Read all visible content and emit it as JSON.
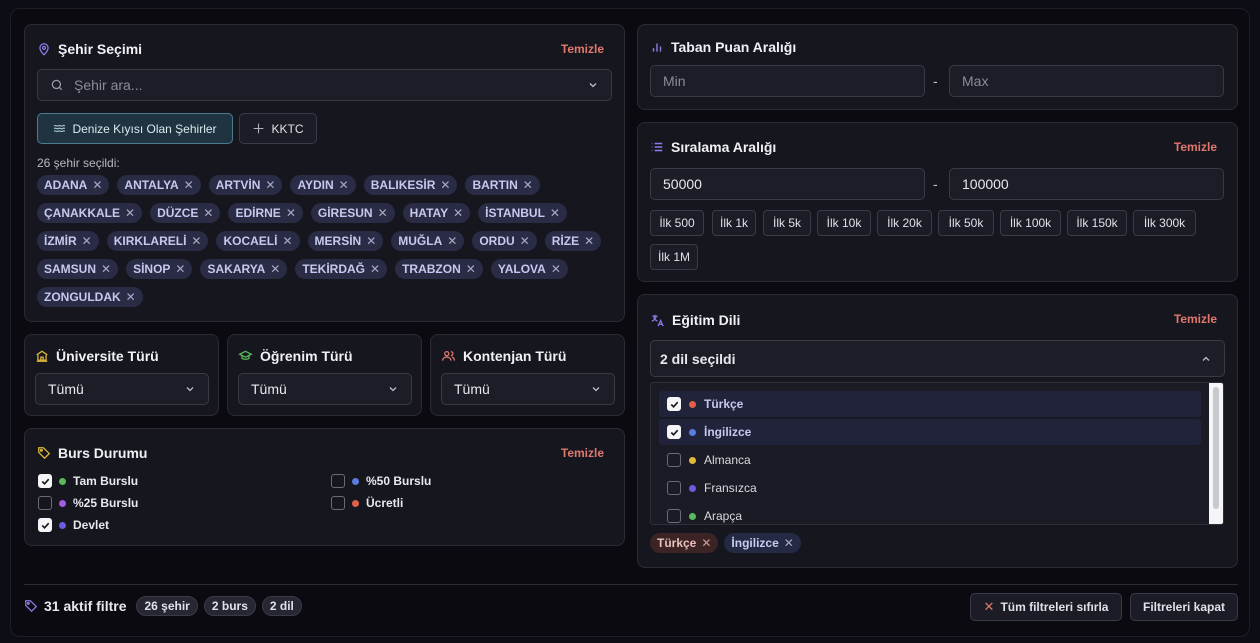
{
  "city": {
    "title": "Şehir Seçimi",
    "clear": "Temizle",
    "search_placeholder": "Şehir ara...",
    "coastal_btn": "Denize Kıyısı Olan Şehirler",
    "kktc_btn": "KKTC",
    "selected_count": "26 şehir seçildi:",
    "cities": [
      "ADANA",
      "ANTALYA",
      "ARTVİN",
      "AYDIN",
      "BALIKESİR",
      "BARTIN",
      "ÇANAKKALE",
      "DÜZCE",
      "EDİRNE",
      "GİRESUN",
      "HATAY",
      "İSTANBUL",
      "İZMİR",
      "KIRKLARELİ",
      "KOCAELİ",
      "MERSİN",
      "MUĞLA",
      "ORDU",
      "RİZE",
      "SAMSUN",
      "SİNOP",
      "SAKARYA",
      "TEKİRDAĞ",
      "TRABZON",
      "YALOVA",
      "ZONGULDAK"
    ]
  },
  "score": {
    "title": "Taban Puan Aralığı",
    "min_placeholder": "Min",
    "max_placeholder": "Max",
    "dash": "-"
  },
  "ranking": {
    "title": "Sıralama Aralığı",
    "clear": "Temizle",
    "min_value": "50000",
    "max_value": "100000",
    "dash": "-",
    "presets": [
      "İlk 500",
      "İlk 1k",
      "İlk 5k",
      "İlk 10k",
      "İlk 20k",
      "İlk 50k",
      "İlk 100k",
      "İlk 150k",
      "İlk 300k",
      "İlk 1M"
    ]
  },
  "university_type": {
    "title": "Üniversite Türü",
    "value": "Tümü"
  },
  "education_type": {
    "title": "Öğrenim Türü",
    "value": "Tümü"
  },
  "quota_type": {
    "title": "Kontenjan Türü",
    "value": "Tümü"
  },
  "scholarship": {
    "title": "Burs Durumu",
    "clear": "Temizle",
    "options": [
      {
        "label": "Tam Burslu",
        "checked": true,
        "color": "#5cb85c"
      },
      {
        "label": "%50 Burslu",
        "checked": false,
        "color": "#5b7be0"
      },
      {
        "label": "%25 Burslu",
        "checked": false,
        "color": "#a55ce0"
      },
      {
        "label": "Ücretli",
        "checked": false,
        "color": "#e0604a"
      },
      {
        "label": "Devlet",
        "checked": true,
        "color": "#6a5ce0"
      }
    ]
  },
  "language": {
    "title": "Eğitim Dili",
    "clear": "Temizle",
    "selected_text": "2 dil seçildi",
    "options": [
      {
        "label": "Türkçe",
        "checked": true,
        "color": "#e0604a"
      },
      {
        "label": "İngilizce",
        "checked": true,
        "color": "#5b7be0"
      },
      {
        "label": "Almanca",
        "checked": false,
        "color": "#e0b83a"
      },
      {
        "label": "Fransızca",
        "checked": false,
        "color": "#6a5ce0"
      },
      {
        "label": "Arapça",
        "checked": false,
        "color": "#5cb85c"
      }
    ],
    "tags": [
      "Türkçe",
      "İngilizce"
    ]
  },
  "footer": {
    "active_count": "31 aktif filtre",
    "badges": [
      "26 şehir",
      "2 burs",
      "2 dil"
    ],
    "reset_btn": "Tüm filtreleri sıfırla",
    "close_btn": "Filtreleri kapat"
  },
  "colors": {
    "accent": "#e0786e",
    "chip_bg": "#2a2b44",
    "card_bg": "#15161e"
  }
}
